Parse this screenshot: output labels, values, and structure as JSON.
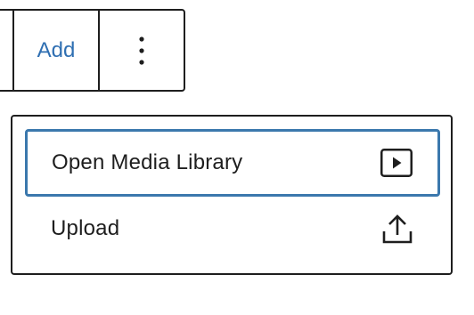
{
  "toolbar": {
    "add_label": "Add",
    "more_icon": "more-vertical-icon"
  },
  "menu": {
    "items": [
      {
        "label": "Open Media Library",
        "icon": "media-play-icon",
        "focused": true
      },
      {
        "label": "Upload",
        "icon": "upload-icon",
        "focused": false
      }
    ]
  },
  "colors": {
    "accent": "#2f6fb2",
    "focus_ring": "#3b78ad",
    "text": "#1e1e1e",
    "border": "#1e1e1e",
    "background": "#ffffff"
  }
}
